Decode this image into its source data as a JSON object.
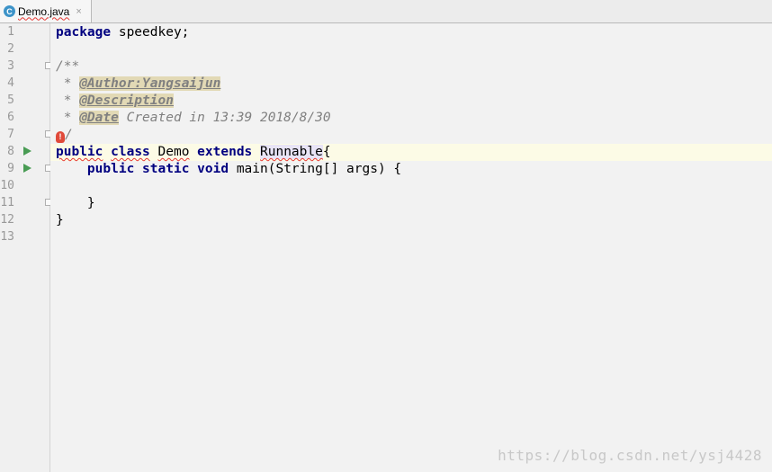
{
  "tab": {
    "icon": "class-c-icon",
    "icon_letter": "C",
    "filename": "Demo.java",
    "close": "×"
  },
  "line_numbers": [
    "1",
    "2",
    "3",
    "4",
    "5",
    "6",
    "7",
    "8",
    "9",
    "10",
    "11",
    "12",
    "13"
  ],
  "code": {
    "l1_kw": "package",
    "l1_rest": " speedkey;",
    "l3": "/**",
    "l4_star": " * ",
    "l4_tag": "@Author:Yangsaijun",
    "l5_star": " * ",
    "l5_tag": "@Description",
    "l6_star": " * ",
    "l6_tag": "@Date",
    "l6_rest": " Created in 13:39 2018/8/30",
    "l7_slash": "/",
    "l8_kw1": "public",
    "l8_kw2": "class",
    "l8_name": "Demo",
    "l8_kw3": "extends",
    "l8_super": "Runnable",
    "l8_brace": "{",
    "l9_kw1": "public",
    "l9_kw2": "static",
    "l9_kw3": "void",
    "l9_rest": " main(String[] args) {",
    "l11": "    }",
    "l12": "}"
  },
  "watermark": "https://blog.csdn.net/ysj4428"
}
